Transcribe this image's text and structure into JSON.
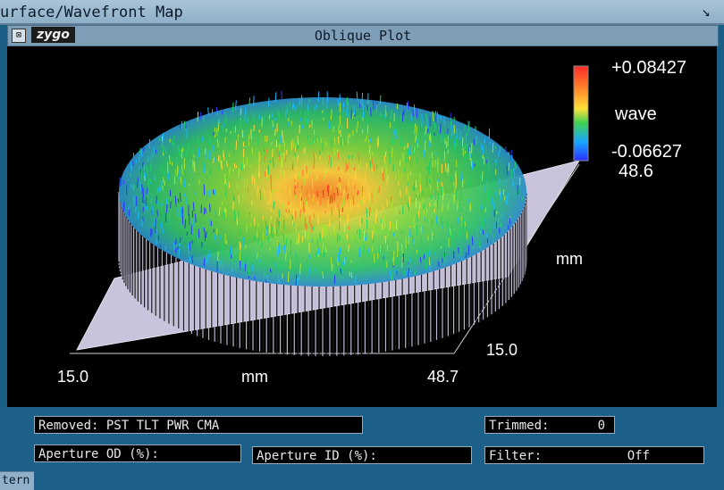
{
  "window": {
    "title": "urface/Wavefront Map",
    "corner_icon": "menu-corner-icon",
    "bottom_tab": "tern"
  },
  "plot_header": {
    "logo": "zygo",
    "title": "Oblique Plot",
    "close_icon": "close-box-icon"
  },
  "plot": {
    "colorbar_max": "+0.08427",
    "colorbar_unit": "wave",
    "colorbar_min": "-0.06627",
    "y_max": "48.6",
    "y_unit": "mm",
    "y_min": "15.0",
    "x_min": "15.0",
    "x_unit": "mm",
    "x_max": "48.7"
  },
  "status": {
    "removed": "Removed: PST TLT PWR CMA",
    "trimmed_label": "Trimmed:",
    "trimmed_value": "0",
    "aperture_od": "Aperture OD (%):",
    "aperture_id": "Aperture ID (%):",
    "filter_label": "Filter:",
    "filter_value": "Off"
  },
  "colors": {
    "background": "#1b5e86",
    "plot_bg": "#000000",
    "plane": "#c9c4dc",
    "colormap": [
      "#2a3cff",
      "#19b8ff",
      "#20d060",
      "#a6e22e",
      "#ffd23a",
      "#ff7a2a",
      "#ff2a2a"
    ]
  }
}
